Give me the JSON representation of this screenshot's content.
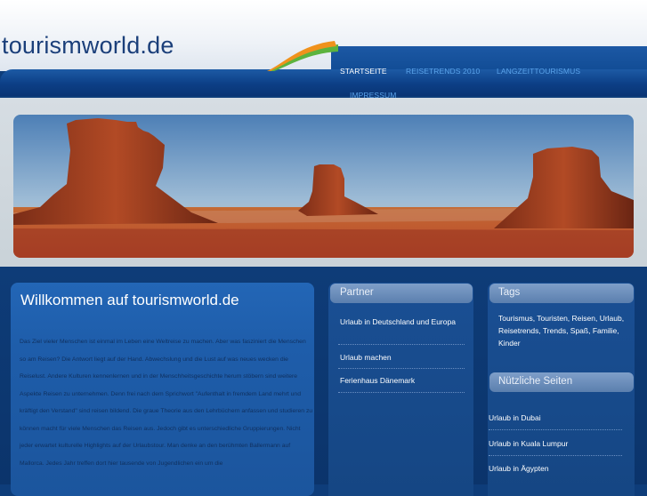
{
  "site": {
    "title": "tourismworld.de"
  },
  "nav": {
    "items": [
      {
        "label": "STARTSEITE",
        "active": true
      },
      {
        "label": "REISETRENDS 2010",
        "active": false
      },
      {
        "label": "LANGZEITTOURISMUS",
        "active": false
      },
      {
        "label": "IMPRESSUM",
        "active": false
      }
    ]
  },
  "hero": {
    "alt_subject": "desert-buttes-landscape"
  },
  "main": {
    "title": "Willkommen auf tourismworld.de",
    "text": "Das Ziel vieler Menschen ist einmal im Leben eine Weltreise zu machen. Aber was fasziniert die Menschen so am Reisen? Die Antwort liegt auf der Hand. Abwechslung und die Lust auf was neues wecken die Reiselust. Andere Kulturen kennenlernen und in der Menschheitsgeschichte herum stöbern sind weitere Aspekte Reisen zu unternehmen. Denn frei nach dem Sprichwort \"Aufenthalt in fremdem Land mehrt und kräftigt den Verstand\" sind reisen bildend. Die graue Theorie aus den Lehrbüchern anfassen und studieren zu können macht für viele Menschen das Reisen aus. Jedoch gibt es unterschiedliche Gruppierungen. Nicht jeder erwartet kulturelle Highlights auf der Urlaubstour. Man denke an den berühmten Ballermann auf Mallorca. Jedes Jahr treffen dort hier tausende von Jugendlichen ein um die"
  },
  "partner": {
    "heading": "Partner",
    "links": [
      "Urlaub in Deutschland und Europa",
      "Urlaub machen",
      "Ferienhaus Dänemark"
    ]
  },
  "tags": {
    "heading": "Tags",
    "text": "Tourismus, Touristen, Reisen, Urlaub, Reisetrends, Trends, Spaß, Familie, Kinder"
  },
  "useful": {
    "heading": "Nützliche Seiten",
    "links": [
      "Urlaub in Dubai",
      "Urlaub in Kuala Lumpur",
      "Urlaub in Ägypten"
    ]
  },
  "colors": {
    "brand_blue": "#1b3f7a",
    "nav_bg": "#0c3f86",
    "nav_link": "#5aa3ea",
    "swoosh_orange": "#f0921c",
    "swoosh_green": "#5cb33e"
  }
}
